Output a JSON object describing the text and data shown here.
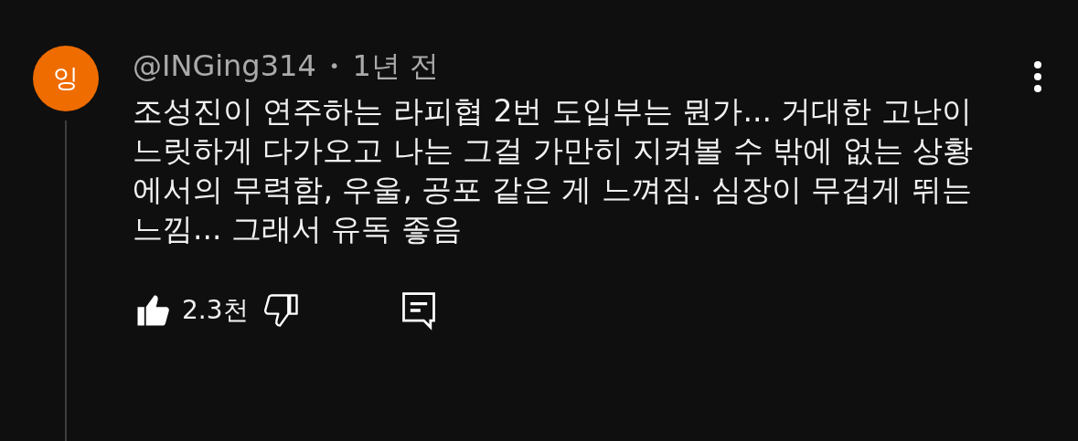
{
  "comment": {
    "avatar_letter": "잉",
    "author": "@INGing314",
    "separator": "•",
    "time": "1년 전",
    "text": "조성진이 연주하는 라피협 2번 도입부는 뭔가... 거대한 고난이 느릿하게 다가오고 나는 그걸 가만히 지켜볼 수 밖에 없는 상황에서의 무력함, 우울, 공포 같은 게 느껴짐. 심장이 무겁게 뛰는 느낌... 그래서 유독 좋음",
    "likes": "2.3천",
    "liked": true,
    "disliked": false
  }
}
